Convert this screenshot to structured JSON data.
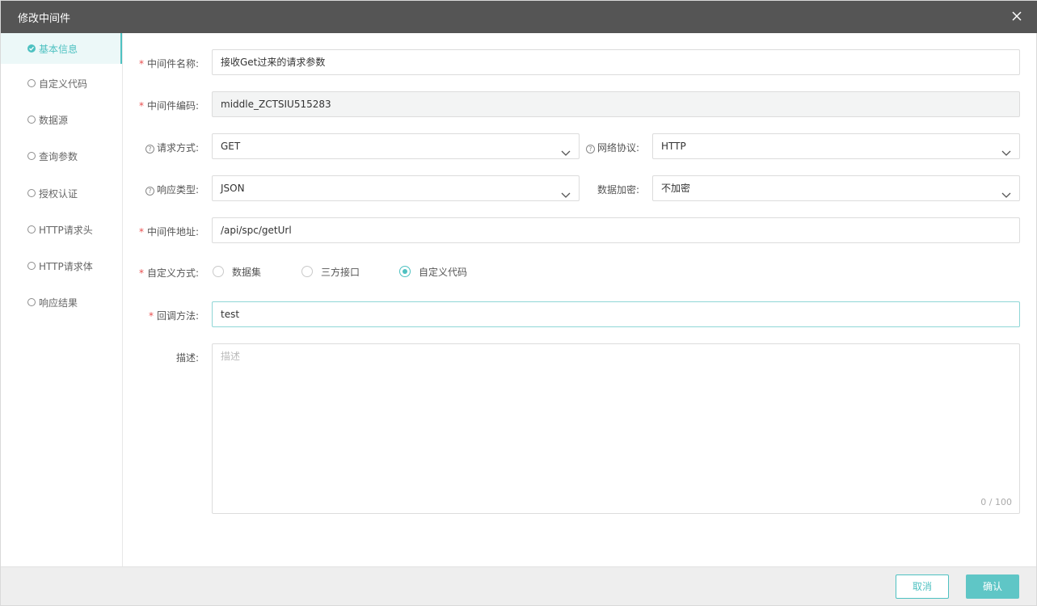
{
  "dialog": {
    "title": "修改中间件"
  },
  "sidebar": {
    "items": [
      {
        "label": "基本信息",
        "active": true
      },
      {
        "label": "自定义代码"
      },
      {
        "label": "数据源"
      },
      {
        "label": "查询参数"
      },
      {
        "label": "授权认证"
      },
      {
        "label": "HTTP请求头"
      },
      {
        "label": "HTTP请求体"
      },
      {
        "label": "响应结果"
      }
    ]
  },
  "form": {
    "required_mark": "*",
    "help_mark": "?",
    "name": {
      "label": "中间件名称:",
      "value": "接收Get过来的请求参数"
    },
    "code": {
      "label": "中间件编码:",
      "value": "middle_ZCTSIU515283"
    },
    "method": {
      "label": "请求方式:",
      "value": "GET"
    },
    "protocol": {
      "label": "网络协议:",
      "value": "HTTP"
    },
    "response_type": {
      "label": "响应类型:",
      "value": "JSON"
    },
    "encryption": {
      "label": "数据加密:",
      "value": "不加密"
    },
    "address": {
      "label": "中间件地址:",
      "value": "/api/spc/getUrl"
    },
    "custom_mode": {
      "label": "自定义方式:",
      "options": [
        "数据集",
        "三方接口",
        "自定义代码"
      ],
      "selected": "自定义代码"
    },
    "callback": {
      "label": "回调方法:",
      "value": "test"
    },
    "description": {
      "label": "描述:",
      "placeholder": "描述",
      "counter": "0 / 100"
    }
  },
  "footer": {
    "cancel_label": "取消",
    "confirm_label": "确认"
  },
  "colors": {
    "accent": "#4ec1c1",
    "titlebar": "#555555",
    "required": "#e84d4d"
  }
}
